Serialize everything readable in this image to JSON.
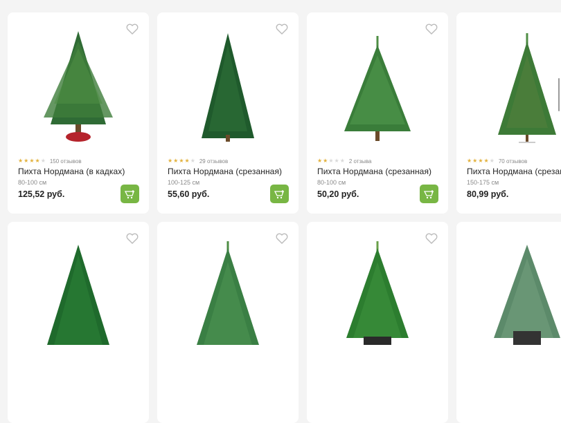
{
  "products": [
    {
      "rating": 4,
      "reviews": "150 отзывов",
      "title": "Пихта Нордмана (в кадках)",
      "size": "80-100 см",
      "price": "125,52 руб."
    },
    {
      "rating": 4,
      "reviews": "29 отзывов",
      "title": "Пихта Нордмана (срезанная)",
      "size": "100-125 см",
      "price": "55,60 руб."
    },
    {
      "rating": 2,
      "reviews": "2 отзыва",
      "title": "Пихта Нордмана (срезанная)",
      "size": "80-100 см",
      "price": "50,20 руб."
    },
    {
      "rating": 4,
      "reviews": "70 отзывов",
      "title": "Пихта Нордмана (срезанная)",
      "size": "150-175 см",
      "price": "80,99 руб."
    }
  ],
  "colors": {
    "accent": "#78b644",
    "star": "#e2b13c",
    "tree_dark": "#1f5a2c",
    "tree_light": "#3f8a3e",
    "pot": "#b5232b"
  },
  "icons": {
    "favorite": "heart-outline-icon",
    "cart": "add-to-cart-icon"
  }
}
